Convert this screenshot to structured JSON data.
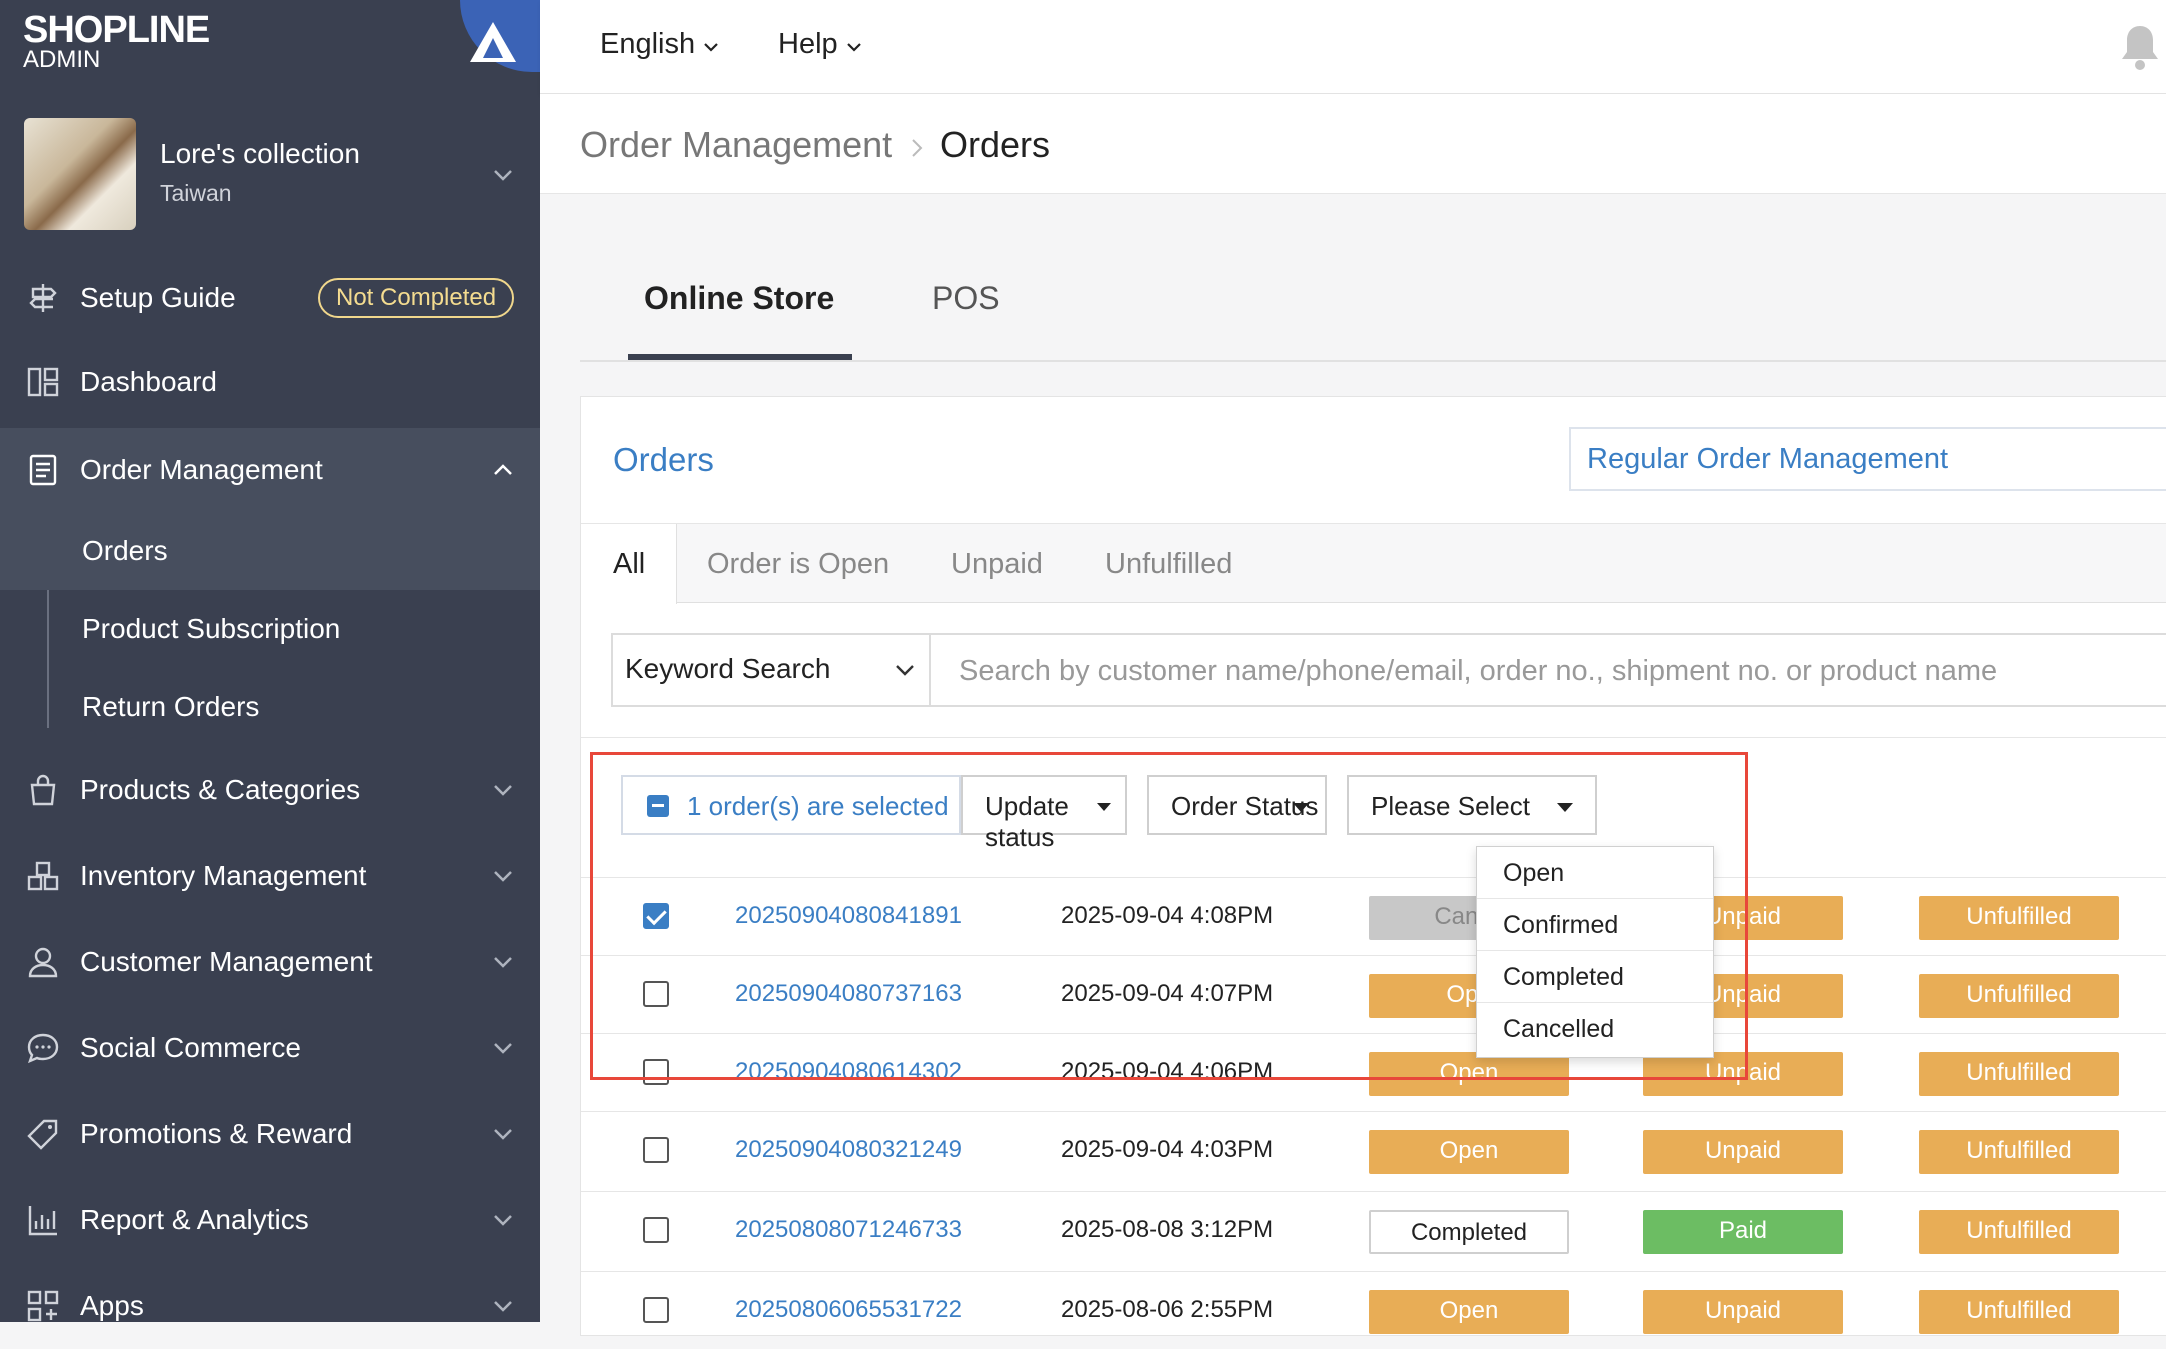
{
  "brand": {
    "name": "SHOPLINE",
    "sub": "ADMIN"
  },
  "store": {
    "name": "Lore's collection",
    "region": "Taiwan"
  },
  "sidebar": {
    "setup_guide": "Setup Guide",
    "setup_badge": "Not Completed",
    "dashboard": "Dashboard",
    "order_management": "Order Management",
    "orders": "Orders",
    "product_subscription": "Product Subscription",
    "return_orders": "Return Orders",
    "products": "Products & Categories",
    "inventory": "Inventory Management",
    "customers": "Customer Management",
    "social": "Social Commerce",
    "promotions": "Promotions & Reward",
    "reports": "Report & Analytics",
    "apps": "Apps"
  },
  "topbar": {
    "language": "English",
    "help": "Help"
  },
  "breadcrumb": {
    "parent": "Order Management",
    "current": "Orders"
  },
  "channel_tabs": [
    "Online Store",
    "POS"
  ],
  "card": {
    "title": "Orders",
    "mode_select": "Regular Order Management"
  },
  "filter_tabs": [
    "All",
    "Order is Open",
    "Unpaid",
    "Unfulfilled"
  ],
  "search": {
    "type": "Keyword Search",
    "placeholder": "Search by customer name/phone/email, order no., shipment no. or product name"
  },
  "bulk": {
    "selected": "1 order(s) are selected",
    "update": "Update status",
    "field": "Order Status",
    "value": "Please Select"
  },
  "dropdown": [
    "Open",
    "Confirmed",
    "Completed",
    "Cancelled"
  ],
  "orders": [
    {
      "id": "20250904080841891",
      "date": "2025-09-04 4:08PM",
      "status": "Cance",
      "payment": "Unpaid",
      "fulfillment": "Unfulfilled",
      "checked": true
    },
    {
      "id": "20250904080737163",
      "date": "2025-09-04 4:07PM",
      "status": "Ope",
      "payment": "Unpaid",
      "fulfillment": "Unfulfilled",
      "checked": false
    },
    {
      "id": "20250904080614302",
      "date": "2025-09-04 4:06PM",
      "status": "Open",
      "payment": "Unpaid",
      "fulfillment": "Unfulfilled",
      "checked": false
    },
    {
      "id": "20250904080321249",
      "date": "2025-09-04 4:03PM",
      "status": "Open",
      "payment": "Unpaid",
      "fulfillment": "Unfulfilled",
      "checked": false
    },
    {
      "id": "20250808071246733",
      "date": "2025-08-08 3:12PM",
      "status": "Completed",
      "payment": "Paid",
      "fulfillment": "Unfulfilled",
      "checked": false
    },
    {
      "id": "20250806065531722",
      "date": "2025-08-06 2:55PM",
      "status": "Open",
      "payment": "Unpaid",
      "fulfillment": "Unfulfilled",
      "checked": false
    }
  ],
  "colors": {
    "sidebar": "#3a4050",
    "accent": "#3a7ec4",
    "orange": "#e8ad56",
    "green": "#6cbd63",
    "highlight": "#e8473a"
  }
}
